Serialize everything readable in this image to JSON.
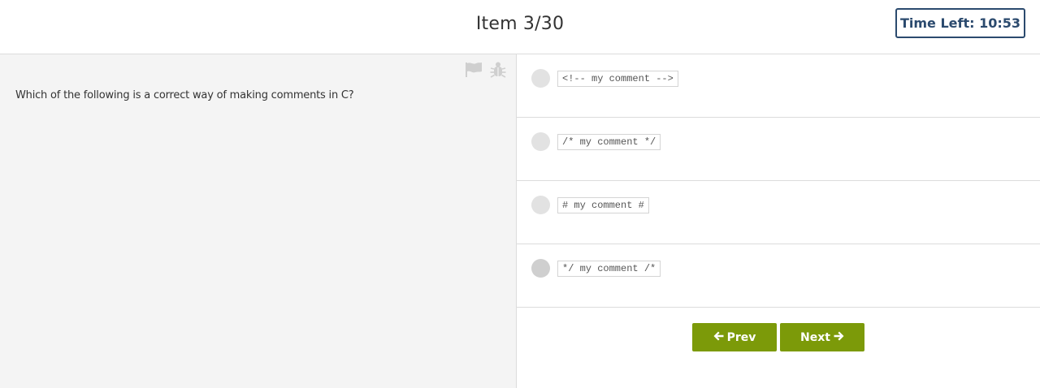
{
  "header": {
    "item_counter": "Item 3/30",
    "time_left": "Time Left: 10:53"
  },
  "question": {
    "text": "Which of the following is a correct way of making comments in C?",
    "tools": [
      {
        "icon": "flag-icon"
      },
      {
        "icon": "bug-icon"
      }
    ]
  },
  "options": [
    {
      "label": "<!-- my comment -->"
    },
    {
      "label": "/* my comment */"
    },
    {
      "label": "# my comment #"
    },
    {
      "label": "*/ my comment /*"
    }
  ],
  "nav": {
    "prev_label": "Prev",
    "next_label": "Next",
    "prev_arrow": "🡐",
    "next_arrow": "🡒"
  },
  "colors": {
    "accent_green": "#7c9a09",
    "timer_navy": "#2b4a6e",
    "panel_gray": "#f4f4f4"
  }
}
